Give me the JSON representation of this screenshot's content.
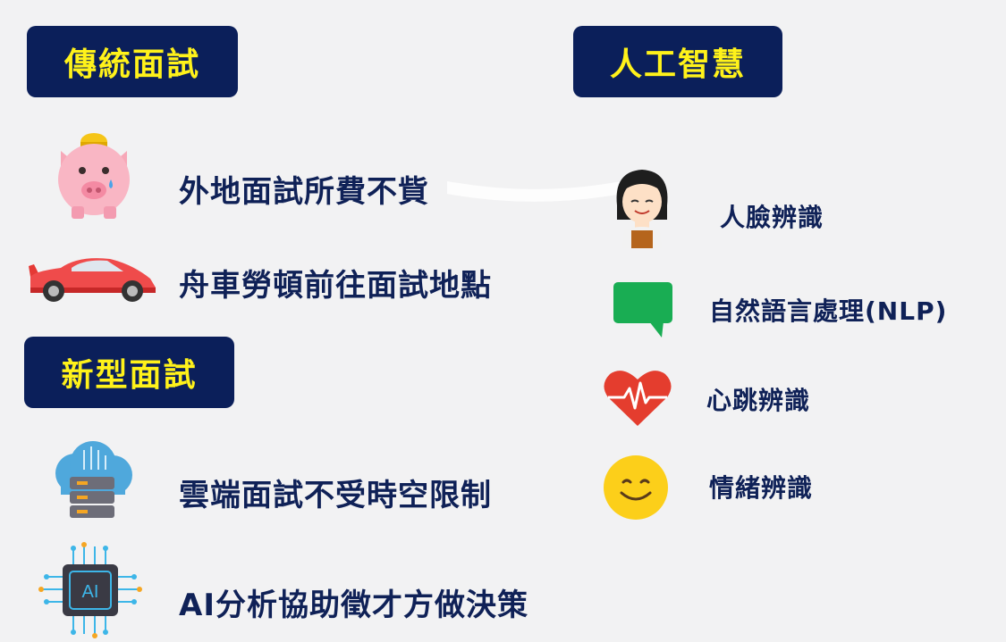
{
  "sections": {
    "traditional": {
      "title": "傳統面試",
      "items": [
        {
          "label": "外地面試所費不貲",
          "icon": "piggy-bank-icon"
        },
        {
          "label": "舟車勞頓前往面試地點",
          "icon": "car-icon"
        }
      ]
    },
    "new_type": {
      "title": "新型面試",
      "items": [
        {
          "label": "雲端面試不受時空限制",
          "icon": "cloud-server-icon"
        },
        {
          "label": "AI分析協助徵才方做決策",
          "icon": "ai-chip-icon"
        }
      ]
    },
    "ai": {
      "title": "人工智慧",
      "items": [
        {
          "label": "人臉辨識",
          "icon": "face-icon"
        },
        {
          "label": "自然語言處理(NLP)",
          "icon": "speech-bubble-icon"
        },
        {
          "label": "心跳辨識",
          "icon": "heartbeat-icon"
        },
        {
          "label": "情緒辨識",
          "icon": "smiley-icon"
        }
      ]
    }
  },
  "chip_text": "AI",
  "colors": {
    "heading_bg": "#0b1f5a",
    "heading_text": "#fff21a",
    "label_text": "#0f2157",
    "background": "#f2f2f3"
  }
}
